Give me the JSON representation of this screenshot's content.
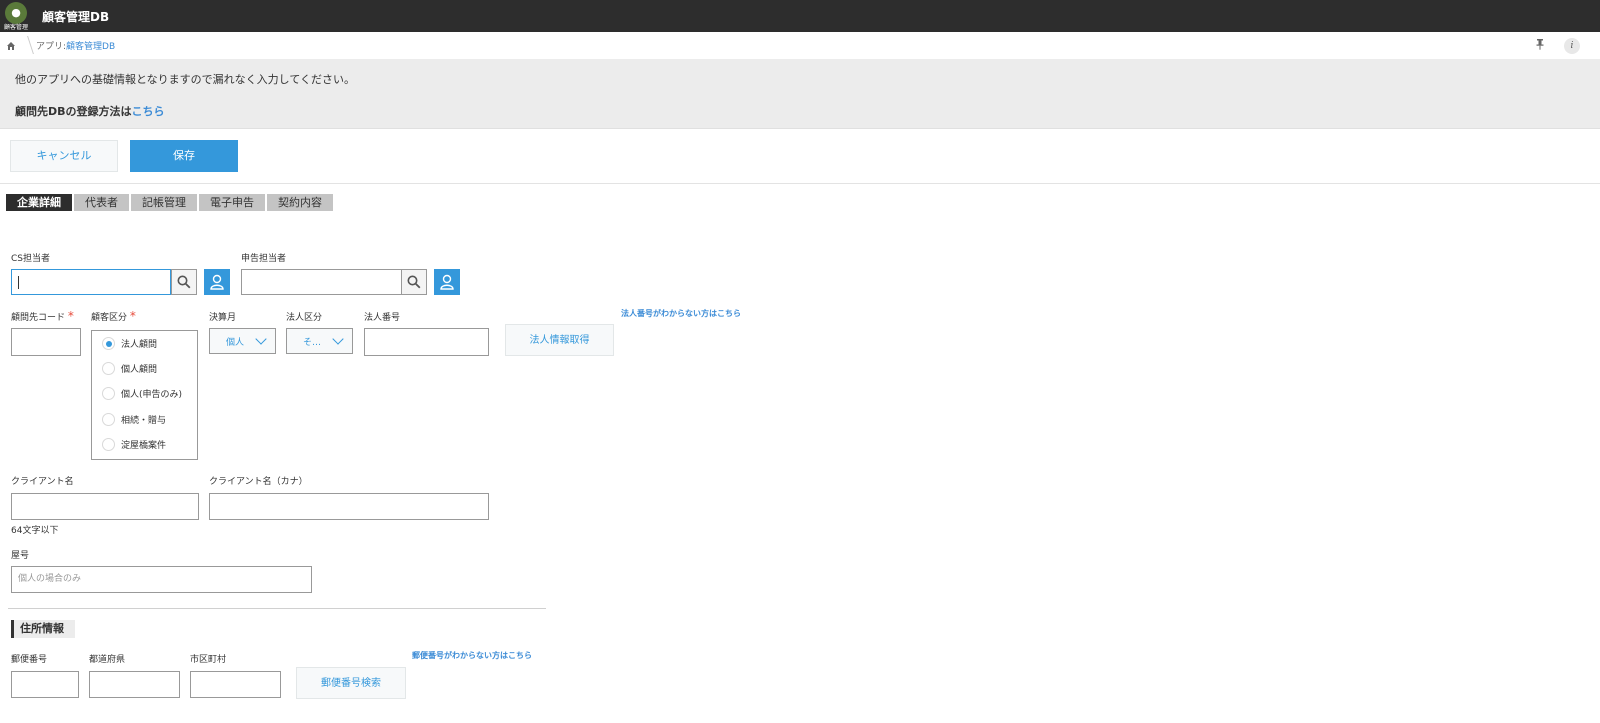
{
  "topbar": {
    "logo_caption": "顧客管理",
    "app_title": "顧客管理DB"
  },
  "breadcrumb": {
    "prefix": "アプリ:",
    "app_link": "顧客管理DB"
  },
  "notice": {
    "line1": "他のアプリへの基礎情報となりますので漏れなく入力してください。",
    "line2_text": "顧問先DBの登録方法は",
    "line2_link": "こちら"
  },
  "actions": {
    "cancel_label": "キャンセル",
    "save_label": "保存"
  },
  "tabs": [
    {
      "label": "企業詳細",
      "active": true
    },
    {
      "label": "代表者",
      "active": false
    },
    {
      "label": "記帳管理",
      "active": false
    },
    {
      "label": "電子申告",
      "active": false
    },
    {
      "label": "契約内容",
      "active": false
    }
  ],
  "form": {
    "cs_staff": {
      "label": "CS担当者",
      "value": ""
    },
    "filing_staff": {
      "label": "申告担当者",
      "value": ""
    },
    "client_code": {
      "label": "顧問先コード",
      "required": "*",
      "value": ""
    },
    "client_type": {
      "label": "顧客区分",
      "required": "*",
      "options": [
        "法人顧問",
        "個人顧問",
        "個人(申告のみ)",
        "相続・贈与",
        "淀屋橋案件"
      ],
      "selected": "法人顧問"
    },
    "fiscal_month": {
      "label": "決算月",
      "value": "個人"
    },
    "corp_type": {
      "label": "法人区分",
      "value": "そ…"
    },
    "corp_number": {
      "label": "法人番号",
      "value": ""
    },
    "corp_info_button": "法人情報取得",
    "corp_number_help_link": "法人番号がわからない方はこちら",
    "client_name": {
      "label": "クライアント名",
      "value": "",
      "hint": "64文字以下"
    },
    "client_name_kana": {
      "label": "クライアント名（カナ）",
      "value": ""
    },
    "trade_name": {
      "label": "屋号",
      "placeholder": "個人の場合のみ"
    }
  },
  "address": {
    "section_title": "住所情報",
    "postal_code": {
      "label": "郵便番号",
      "value": ""
    },
    "prefecture": {
      "label": "都道府県",
      "value": ""
    },
    "city": {
      "label": "市区町村",
      "value": ""
    },
    "postal_search_button": "郵便番号検索",
    "postal_help_link": "郵便番号がわからない方はこちら"
  },
  "colors": {
    "accent": "#3498db",
    "topbar": "#2d2d2d",
    "required": "#e74c3c"
  }
}
